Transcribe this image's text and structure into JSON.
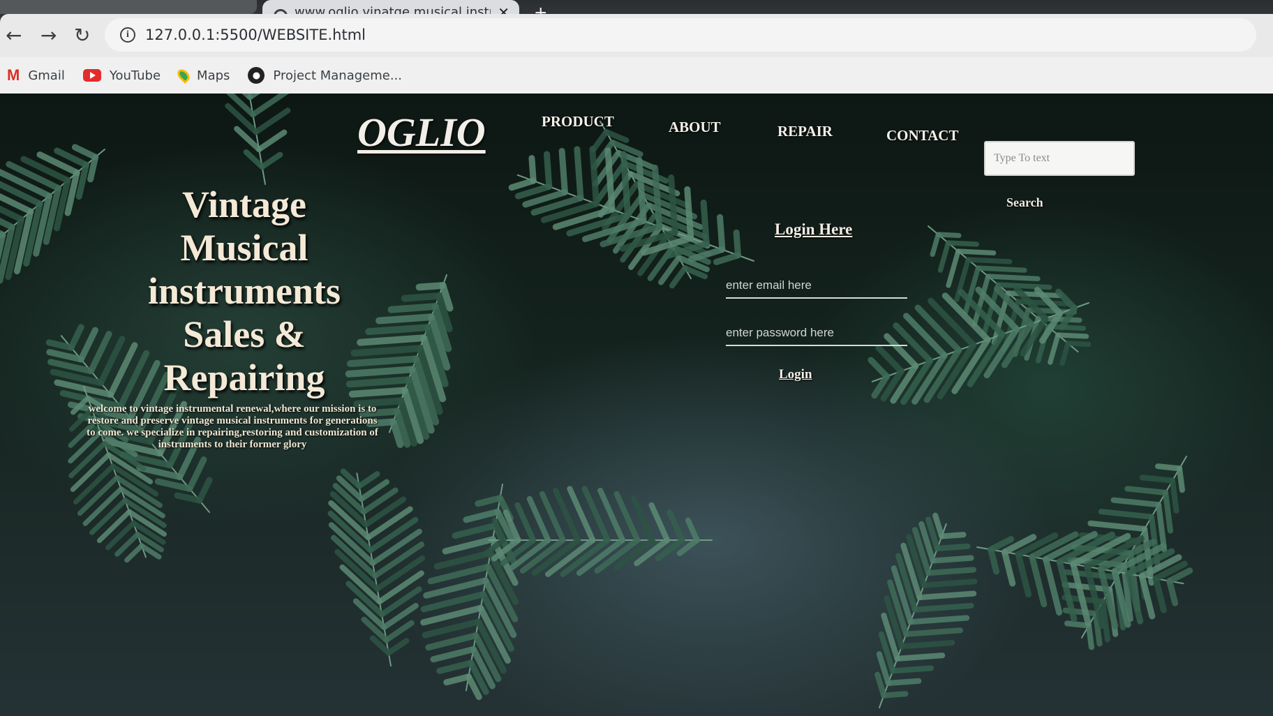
{
  "browser": {
    "tab_title": "www.oglio vinatge musical instru",
    "tab_close": "✕",
    "new_tab": "+",
    "nav": {
      "back": "←",
      "forward": "→",
      "reload": "↻"
    },
    "url": "127.0.0.1:5500/WEBSITE.html",
    "bookmarks": [
      {
        "label": "Gmail",
        "icon": "gmail-icon"
      },
      {
        "label": "YouTube",
        "icon": "youtube-icon"
      },
      {
        "label": "Maps",
        "icon": "maps-icon"
      },
      {
        "label": "Project Manageme...",
        "icon": "project-icon"
      }
    ]
  },
  "site": {
    "logo": "OGLIO",
    "nav": [
      "PRODUCT",
      "ABOUT",
      "REPAIR",
      "CONTACT"
    ],
    "search": {
      "placeholder": "Type To text",
      "button": "Search"
    },
    "hero": {
      "title_lines": [
        "Vintage",
        "Musical",
        "instruments",
        "Sales &",
        "Repairing"
      ],
      "text": "welcome to vintage instrumental renewal,where our mission is to restore and preserve vintage musical instruments for generations to come. we specialize in repairing,restoring and customization of instruments to their former glory"
    },
    "login": {
      "title": "Login Here",
      "email_placeholder": "enter email here",
      "password_placeholder": "enter password here",
      "button": "Login"
    }
  },
  "colors": {
    "foliage": "#2f5a48",
    "text": "#f4e9d6"
  }
}
